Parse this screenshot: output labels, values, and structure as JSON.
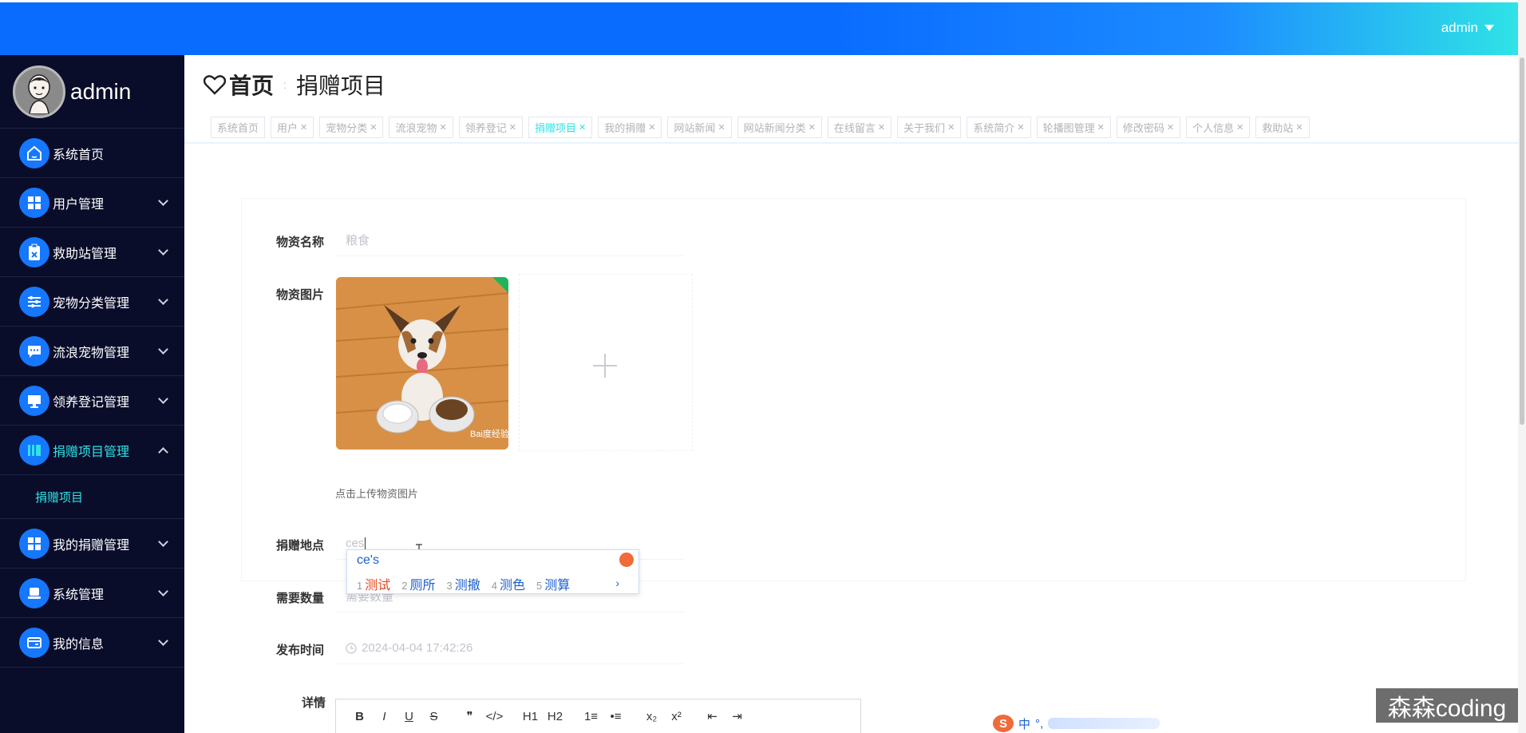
{
  "header": {
    "username": "admin"
  },
  "sidebar": {
    "profile_name": "admin",
    "items": [
      {
        "label": "系统首页"
      },
      {
        "label": "用户管理"
      },
      {
        "label": "救助站管理"
      },
      {
        "label": "宠物分类管理"
      },
      {
        "label": "流浪宠物管理"
      },
      {
        "label": "领养登记管理"
      },
      {
        "label": "捐赠项目管理"
      },
      {
        "label": "我的捐赠管理"
      },
      {
        "label": "系统管理"
      },
      {
        "label": "我的信息"
      }
    ],
    "sub_item": "捐赠项目"
  },
  "breadcrumb": {
    "home": "首页",
    "current": "捐赠项目"
  },
  "tags": [
    {
      "label": "系统首页",
      "closable": false
    },
    {
      "label": "用户",
      "closable": true
    },
    {
      "label": "宠物分类",
      "closable": true
    },
    {
      "label": "流浪宠物",
      "closable": true
    },
    {
      "label": "领养登记",
      "closable": true
    },
    {
      "label": "捐赠项目",
      "closable": true,
      "active": true
    },
    {
      "label": "我的捐赠",
      "closable": true
    },
    {
      "label": "网站新闻",
      "closable": true
    },
    {
      "label": "网站新闻分类",
      "closable": true
    },
    {
      "label": "在线留言",
      "closable": true
    },
    {
      "label": "关于我们",
      "closable": true
    },
    {
      "label": "系统简介",
      "closable": true
    },
    {
      "label": "轮播图管理",
      "closable": true
    },
    {
      "label": "修改密码",
      "closable": true
    },
    {
      "label": "个人信息",
      "closable": true
    },
    {
      "label": "救助站",
      "closable": true
    }
  ],
  "form": {
    "name_label": "物资名称",
    "name_value": "粮食",
    "image_label": "物资图片",
    "image_hint": "点击上传物资图片",
    "image_watermark": "Bai度经验",
    "location_label": "捐赠地点",
    "location_value": "ces",
    "quantity_label": "需要数量",
    "quantity_placeholder": "需要数量",
    "time_label": "发布时间",
    "time_value": "2024-04-04 17:42:26",
    "detail_label": "详情"
  },
  "ime": {
    "composition": "ce's",
    "candidates": [
      {
        "n": "1",
        "text": "测试"
      },
      {
        "n": "2",
        "text": "厕所"
      },
      {
        "n": "3",
        "text": "测撤"
      },
      {
        "n": "4",
        "text": "测色"
      },
      {
        "n": "5",
        "text": "测算"
      }
    ],
    "more": "›"
  },
  "editor_toolbar": [
    "B",
    "I",
    "U",
    "S",
    "❞",
    "</>",
    "H1",
    "H2",
    "1≡",
    "•≡",
    "x₂",
    "x²",
    "⇤",
    "⇥"
  ],
  "ime_status": {
    "lang": "中",
    "punct": "°,"
  },
  "watermark": "森森coding",
  "colors": {
    "accent": "#1677ff",
    "active": "#2fe3e6",
    "sidebar_bg": "#090d2a"
  }
}
